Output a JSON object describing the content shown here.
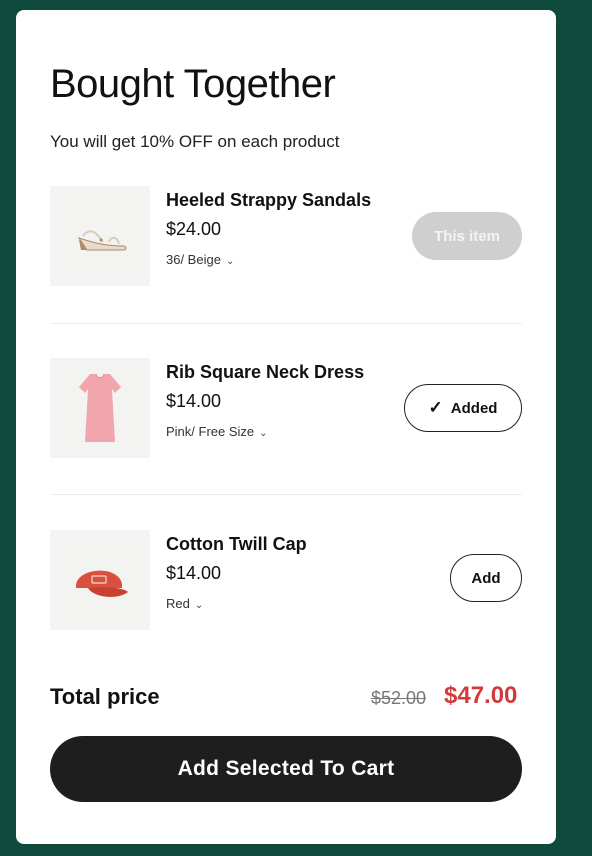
{
  "header": {
    "title": "Bought Together",
    "subtitle": "You will get 10% OFF on each product"
  },
  "products": [
    {
      "name": "Heeled Strappy Sandals",
      "price": "$24.00",
      "variant": "36/ Beige",
      "button": "This item",
      "icon": "sandal-icon"
    },
    {
      "name": "Rib Square Neck Dress",
      "price": "$14.00",
      "variant": "Pink/ Free Size",
      "button": "Added",
      "icon": "dress-icon"
    },
    {
      "name": "Cotton Twill Cap",
      "price": "$14.00",
      "variant": "Red",
      "button": "Add",
      "icon": "cap-icon"
    }
  ],
  "summary": {
    "total_label": "Total price",
    "original_price": "$52.00",
    "discounted_price": "$47.00"
  },
  "cart_button": "Add Selected To Cart",
  "colors": {
    "background": "#0f4a3c",
    "accent_red": "#d13b3b",
    "dark_button": "#1e1e1e"
  }
}
